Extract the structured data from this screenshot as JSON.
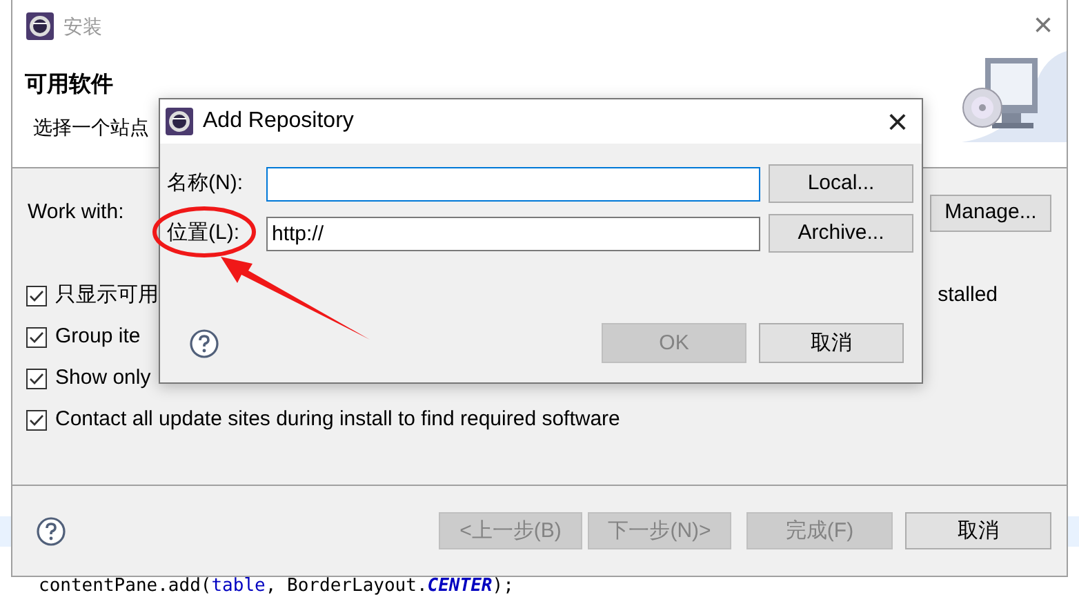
{
  "editor": {
    "code_line": [
      {
        "kind": "plain",
        "text": "contentPane.add("
      },
      {
        "kind": "field",
        "text": "table"
      },
      {
        "kind": "plain",
        "text": ", BorderLayout."
      },
      {
        "kind": "constant",
        "text": "CENTER"
      },
      {
        "kind": "plain",
        "text": ");"
      }
    ]
  },
  "install_window": {
    "title": "安装",
    "close": "×",
    "header_title": "可用软件",
    "header_text": "选择一个站点",
    "work_with": {
      "label": "Work with:",
      "manage_button": "Manage..."
    },
    "checkboxes": [
      {
        "label": "只显示可用",
        "tail": "stalled",
        "checked": true
      },
      {
        "label": "Group ite",
        "checked": true
      },
      {
        "label": "Show only",
        "checked": true
      },
      {
        "label": "Contact all update sites during install to find required software",
        "checked": true
      }
    ],
    "buttons": [
      {
        "label": "<上一步(B)",
        "disabled": true
      },
      {
        "label": "下一步(N)>",
        "disabled": true
      },
      {
        "label": "完成(F)",
        "disabled": true
      },
      {
        "label": "取消",
        "disabled": false
      }
    ]
  },
  "add_repository": {
    "title": "Add Repository",
    "close": "×",
    "fields": [
      {
        "label": "名称(N):",
        "focused": true,
        "button": "Local..."
      },
      {
        "label": "位置(L):",
        "value": "http://",
        "focused": false,
        "button": "Archive..."
      }
    ],
    "buttons": [
      {
        "label": "OK",
        "disabled": true
      },
      {
        "label": "取消",
        "disabled": false
      }
    ]
  }
}
